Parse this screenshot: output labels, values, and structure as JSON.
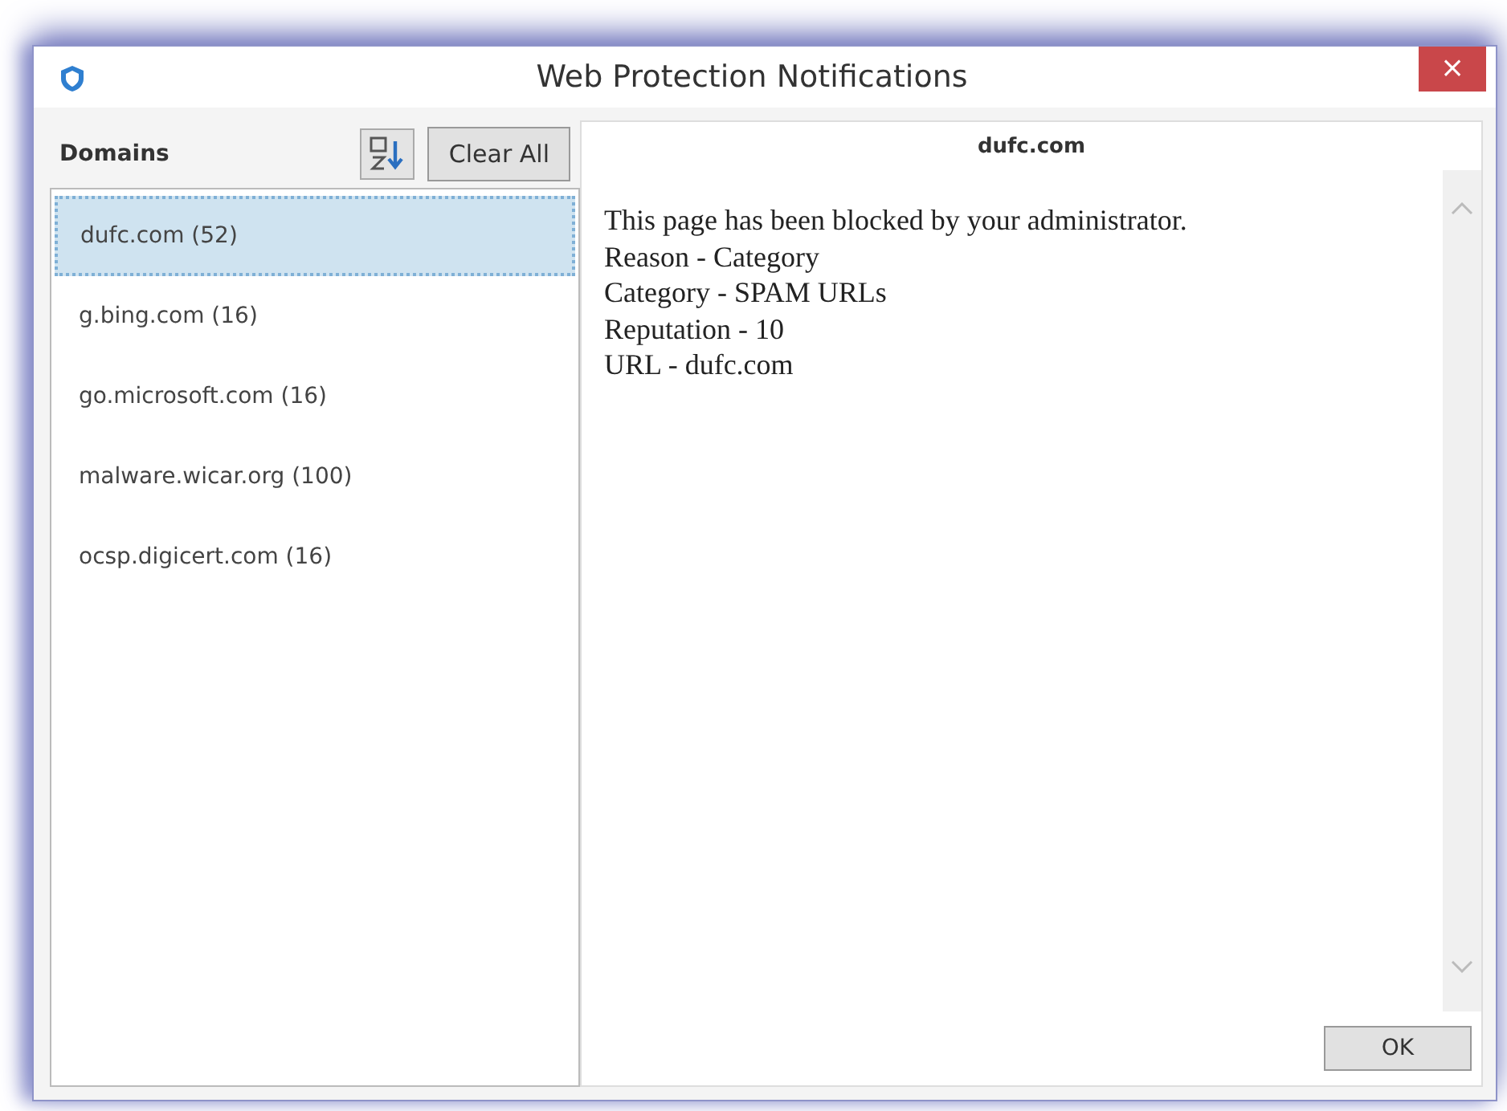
{
  "window": {
    "title": "Web Protection Notifications",
    "close": "×"
  },
  "domains_panel": {
    "header": "Domains",
    "clear_button": "Clear All",
    "items": [
      {
        "name": "dufc.com",
        "count": "(52)",
        "selected": true
      },
      {
        "name": "g.bing.com",
        "count": "(16)",
        "selected": false
      },
      {
        "name": "go.microsoft.com",
        "count": "(16)",
        "selected": false
      },
      {
        "name": "malware.wicar.org",
        "count": "(100)",
        "selected": false
      },
      {
        "name": "ocsp.digicert.com",
        "count": "(16)",
        "selected": false
      }
    ]
  },
  "detail": {
    "heading": "dufc.com",
    "lines": [
      "This page has been blocked by your administrator.",
      "Reason - Category",
      "Category - SPAM URLs",
      "Reputation - 10",
      "URL - dufc.com"
    ]
  },
  "buttons": [
    "OK"
  ]
}
